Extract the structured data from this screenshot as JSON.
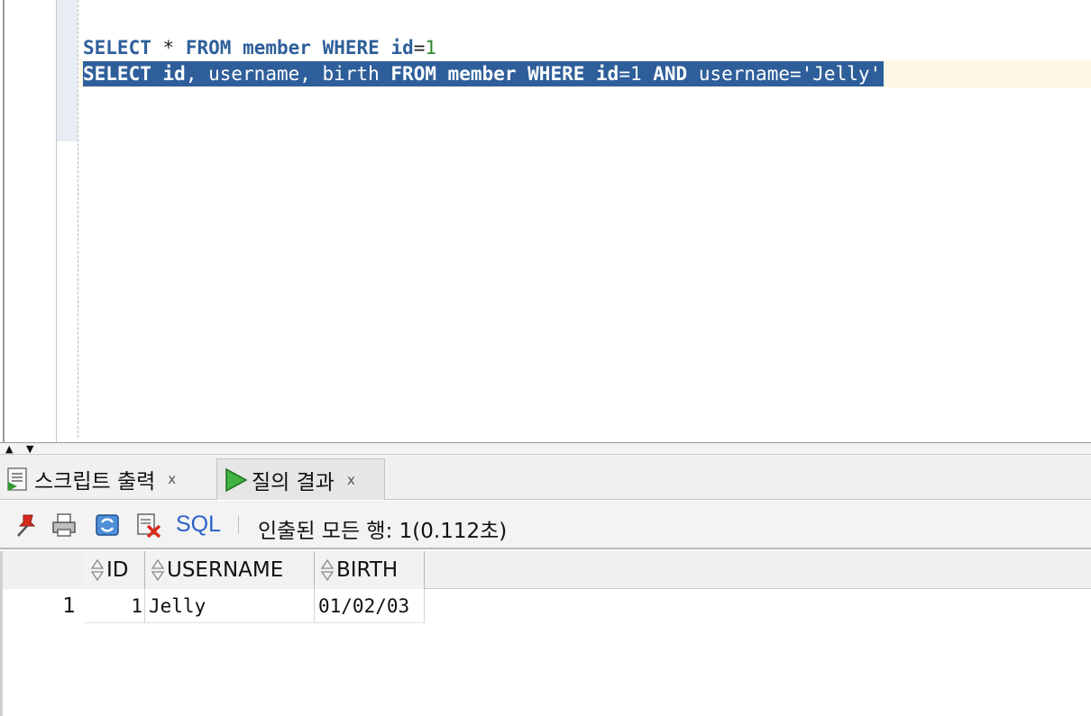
{
  "editor": {
    "line1": [
      {
        "text": "SELECT",
        "cls": "kw"
      },
      {
        "text": " ",
        "cls": "op"
      },
      {
        "text": "*",
        "cls": "op"
      },
      {
        "text": " ",
        "cls": "op"
      },
      {
        "text": "FROM",
        "cls": "kw"
      },
      {
        "text": " ",
        "cls": "op"
      },
      {
        "text": "member",
        "cls": "kw"
      },
      {
        "text": " ",
        "cls": "op"
      },
      {
        "text": "WHERE",
        "cls": "kw"
      },
      {
        "text": " ",
        "cls": "op"
      },
      {
        "text": "id",
        "cls": "kw"
      },
      {
        "text": "=",
        "cls": "op"
      },
      {
        "text": "1",
        "cls": "num"
      }
    ],
    "line2": [
      {
        "text": "SELECT",
        "cls": "kw"
      },
      {
        "text": " ",
        "cls": "op"
      },
      {
        "text": "id",
        "cls": "kw"
      },
      {
        "text": ",",
        "cls": "op"
      },
      {
        "text": " username, birth ",
        "cls": "id"
      },
      {
        "text": "FROM",
        "cls": "kw"
      },
      {
        "text": " ",
        "cls": "op"
      },
      {
        "text": "member",
        "cls": "kw"
      },
      {
        "text": " ",
        "cls": "op"
      },
      {
        "text": "WHERE",
        "cls": "kw"
      },
      {
        "text": " ",
        "cls": "op"
      },
      {
        "text": "id",
        "cls": "kw"
      },
      {
        "text": "=1 ",
        "cls": "op"
      },
      {
        "text": "AND",
        "cls": "kw"
      },
      {
        "text": " username='Jelly'",
        "cls": "id"
      }
    ]
  },
  "tabs": {
    "script_output": {
      "label": "스크립트 출력",
      "close": "x",
      "icon": "script-output-icon"
    },
    "query_result": {
      "label": "질의 결과",
      "close": "x",
      "icon": "run-query-icon"
    }
  },
  "toolbar": {
    "icons": [
      "pin-icon",
      "print-icon",
      "refresh-icon",
      "cancel-query-icon"
    ],
    "sql_label": "SQL",
    "status": "인출된 모든 행: 1(0.112초)"
  },
  "results": {
    "columns": [
      "ID",
      "USERNAME",
      "BIRTH"
    ],
    "rows": [
      {
        "row_number": "1",
        "cells": [
          "1",
          "Jelly",
          "01/02/03"
        ]
      }
    ]
  },
  "colors": {
    "selection": "#2f5f9a",
    "keyword": "#2e5f9b",
    "number": "#2d8a2d",
    "current_line": "#fdf7e6",
    "sql_link": "#2a62c9"
  }
}
